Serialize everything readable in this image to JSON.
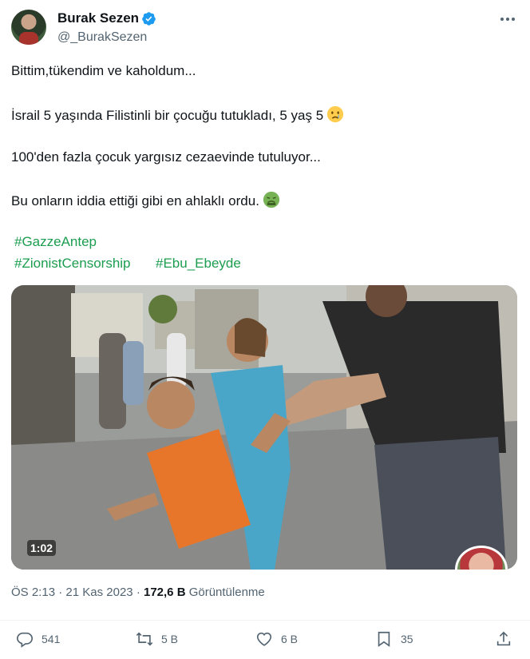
{
  "author": {
    "name": "Burak Sezen",
    "handle": "@_BurakSezen",
    "verified": true
  },
  "tweet": {
    "line1": "Bittim,tükendim ve kaholdum...",
    "line2": "İsrail 5 yaşında Filistinli bir çocuğu tutukladı, 5 yaş 5",
    "line2_emoji": "crying-face",
    "line3": "100'den fazla çocuk yargısız cezaevinde tutuluyor...",
    "line4": "Bu onların iddia ettiği gibi en ahlaklı ordu.",
    "line4_emoji": "nauseated-face",
    "hashtags": [
      "#GazzeAntep",
      "#ZionistCensorship",
      "#Ebu_Ebeyde"
    ]
  },
  "media": {
    "type": "video",
    "duration": "1:02"
  },
  "meta": {
    "time": "ÖS 2:13",
    "separator": "·",
    "date": "21 Kas 2023",
    "views": "172,6 B",
    "views_label": "Görüntülenme"
  },
  "actions": {
    "replies": "541",
    "reposts": "5 B",
    "likes": "6 B",
    "bookmarks": "35"
  },
  "colors": {
    "hashtag": "#1c9d4f",
    "verified": "#1d9bf0",
    "secondary_text": "#536471"
  }
}
